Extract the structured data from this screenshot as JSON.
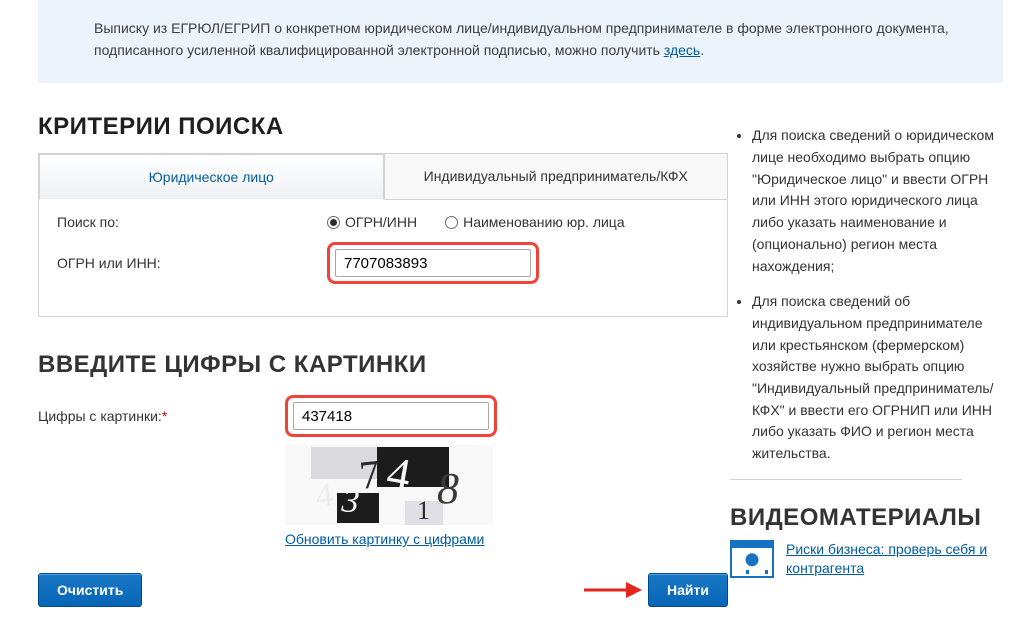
{
  "note": {
    "text_a": "Выписку из ЕГРЮЛ/ЕГРИП о конкретном юридическом лице/индивидуальном предпринимателе в форме электронного документа, подписанного усиленной квалифицированной электронной подписью, можно получить ",
    "link": "здесь",
    "text_b": "."
  },
  "headings": {
    "criteria": "КРИТЕРИИ ПОИСКА",
    "captcha": "ВВЕДИТЕ ЦИФРЫ С КАРТИНКИ",
    "video": "ВИДЕОМАТЕРИАЛЫ"
  },
  "tabs": {
    "legal": "Юридическое лицо",
    "entrep": "Индивидуальный предприниматель/КФХ"
  },
  "labels": {
    "search_by": "Поиск по:",
    "ogrn_or_inn": "ОГРН или ИНН:",
    "captcha": "Цифры с картинки:"
  },
  "radio": {
    "ogrn": "ОГРН/ИНН",
    "name": "Наименованию юр. лица"
  },
  "inputs": {
    "ogrn_value": "7707083893",
    "captcha_value": "437418"
  },
  "links": {
    "refresh_captcha": "Обновить картинку с цифрами",
    "video": "Риски бизнеса: проверь себя и контрагента"
  },
  "buttons": {
    "clear": "Очистить",
    "find": "Найти"
  },
  "help": {
    "p1": "Для поиска сведений о юридическом лице необходимо выбрать опцию \"Юридическое лицо\" и ввести ОГРН или ИНН этого юридического лица либо указать наименование и (опционально) регион места нахождения;",
    "p2": "Для поиска сведений об индивидуальном предпринимателе или крестьянском (фермерском) хозяйстве нужно выбрать опцию \"Индивидуальный предприниматель/КФХ\" и ввести его ОГРНИП или ИНН либо указать ФИО и регион места жительства."
  },
  "captcha_digits": "437418"
}
